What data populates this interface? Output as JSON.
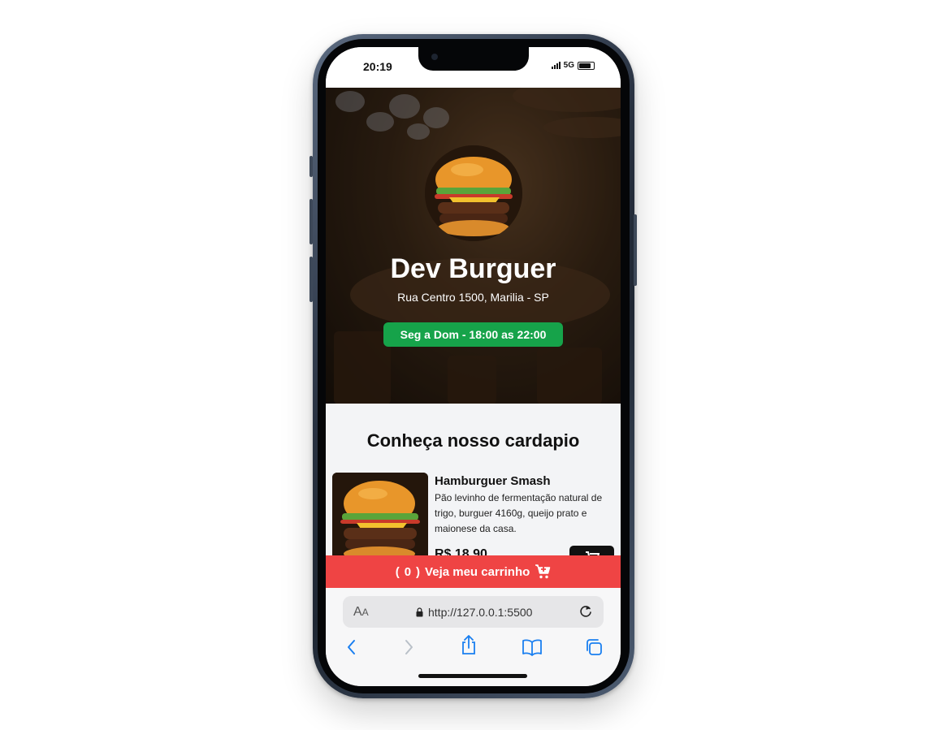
{
  "status_bar": {
    "time": "20:19",
    "network": "5G"
  },
  "header": {
    "title": "Dev Burguer",
    "address": "Rua Centro 1500, Marilia - SP",
    "hours": "Seg a Dom - 18:00 as 22:00"
  },
  "menu": {
    "heading": "Conheça nosso cardapio",
    "items": [
      {
        "name": "Hamburguer Smash",
        "description": "Pão levinho de fermentação natural de trigo, burguer 4160g, queijo prato e maionese da casa.",
        "price": "R$ 18,90"
      }
    ]
  },
  "cart": {
    "count": "0",
    "label": "Veja meu carrinho"
  },
  "browser": {
    "text_size_label": "AA",
    "url": "http://127.0.0.1:5500"
  },
  "colors": {
    "accent_green": "#16a34a",
    "cart_red": "#ef4444",
    "ios_blue": "#1a7ff0"
  }
}
